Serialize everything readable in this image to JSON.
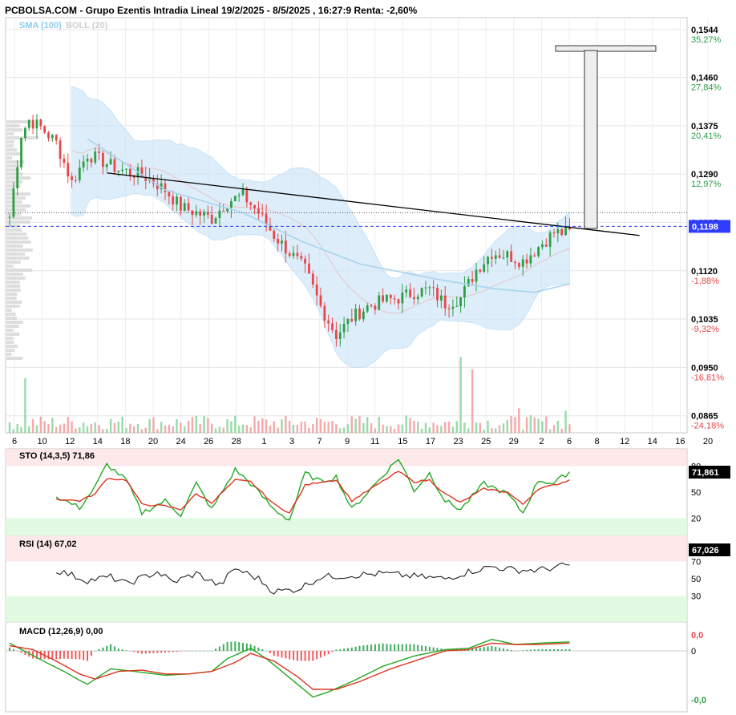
{
  "title": "PCBOLSA.COM - Grupo Ezentis Intradia Lineal 19/2/2025 - 8/5/2025 , 16:27:9 Renta: -2,60%",
  "legend": {
    "sma": "SMA (100)",
    "boll": "BOLL (20)"
  },
  "colors": {
    "up": "#2e9e44",
    "down": "#e8474a",
    "sma": "#a8d4ee",
    "boll_fill": "#cfe6f8",
    "trend": "#000000",
    "price_line": "#2f3cff",
    "stoch_k": "#22aa22",
    "stoch_d": "#dd3322",
    "rsi": "#222222"
  },
  "price_axis": [
    {
      "price": "0,1544",
      "pct": "35,27%"
    },
    {
      "price": "0,1460",
      "pct": "27,84%"
    },
    {
      "price": "0,1375",
      "pct": "20,41%"
    },
    {
      "price": "0,1290",
      "pct": "12,97%"
    },
    {
      "price": "0,1205",
      "pct": ""
    },
    {
      "price": "0,1120",
      "pct": "-1,88%"
    },
    {
      "price": "0,1035",
      "pct": "-9,32%"
    },
    {
      "price": "0,0950",
      "pct": "-16,81%"
    },
    {
      "price": "0,0865",
      "pct": "-24,18%"
    }
  ],
  "current_price": "0,1198",
  "date_labels": [
    "6",
    "10",
    "12",
    "14",
    "18",
    "20",
    "24",
    "26",
    "28",
    "1",
    "3",
    "7",
    "9",
    "11",
    "15",
    "17",
    "23",
    "25",
    "29",
    "2",
    "6",
    "8",
    "12",
    "14",
    "16",
    "20"
  ],
  "chart_data": [
    {
      "type": "candlestick",
      "title": "PCBOLSA.COM - Grupo Ezentis Intradia Lineal 19/2/2025 - 8/5/2025 , 16:27:9 Renta: -2,60%",
      "x_tick_labels": [
        "6",
        "10",
        "12",
        "14",
        "18",
        "20",
        "24",
        "26",
        "28",
        "1",
        "3",
        "7",
        "9",
        "11",
        "15",
        "17",
        "23",
        "25",
        "29",
        "2",
        "6",
        "8",
        "12",
        "14",
        "16",
        "20"
      ],
      "ylim": [
        0.0835,
        0.1565
      ],
      "close_path": [
        [
          0,
          0.1215
        ],
        [
          3,
          0.136
        ],
        [
          5,
          0.1385
        ],
        [
          8,
          0.1372
        ],
        [
          12,
          0.1345
        ],
        [
          16,
          0.1275
        ],
        [
          20,
          0.1325
        ],
        [
          24,
          0.1312
        ],
        [
          28,
          0.1298
        ],
        [
          32,
          0.1292
        ],
        [
          36,
          0.1282
        ],
        [
          40,
          0.1262
        ],
        [
          44,
          0.1232
        ],
        [
          48,
          0.1222
        ],
        [
          52,
          0.1212
        ],
        [
          56,
          0.1242
        ],
        [
          60,
          0.1252
        ],
        [
          64,
          0.1222
        ],
        [
          68,
          0.1182
        ],
        [
          72,
          0.1152
        ],
        [
          76,
          0.1122
        ],
        [
          80,
          0.1057
        ],
        [
          84,
          0.1007
        ],
        [
          88,
          0.1037
        ],
        [
          92,
          0.1057
        ],
        [
          96,
          0.1067
        ],
        [
          100,
          0.1072
        ],
        [
          104,
          0.1082
        ],
        [
          108,
          0.1087
        ],
        [
          112,
          0.1062
        ],
        [
          116,
          0.1072
        ],
        [
          120,
          0.1122
        ],
        [
          124,
          0.1152
        ],
        [
          128,
          0.1147
        ],
        [
          132,
          0.1137
        ],
        [
          136,
          0.1162
        ],
        [
          140,
          0.1187
        ],
        [
          144,
          0.1187
        ]
      ],
      "sma_100": [
        [
          20,
          0.1352
        ],
        [
          40,
          0.1262
        ],
        [
          60,
          0.1222
        ],
        [
          75,
          0.1172
        ],
        [
          90,
          0.1132
        ],
        [
          110,
          0.1105
        ],
        [
          125,
          0.1088
        ],
        [
          135,
          0.1082
        ],
        [
          144,
          0.1097
        ]
      ],
      "trendline": [
        [
          25,
          0.1292
        ],
        [
          162,
          0.1182
        ]
      ],
      "reference_line": 0.1222,
      "current_price": 0.1198,
      "volume_spikes": [
        [
          4,
          0.62
        ],
        [
          116,
          0.86
        ],
        [
          119,
          0.72
        ],
        [
          131,
          0.28
        ],
        [
          143,
          0.25
        ]
      ]
    },
    {
      "type": "line",
      "title": "STO (14,3,5)",
      "value": "71,86",
      "last": "71,861",
      "ylim": [
        0,
        100
      ],
      "bands": [
        20,
        80
      ],
      "k": [
        [
          12,
          45
        ],
        [
          18,
          32
        ],
        [
          22,
          56
        ],
        [
          25,
          82
        ],
        [
          30,
          64
        ],
        [
          34,
          26
        ],
        [
          40,
          40
        ],
        [
          44,
          24
        ],
        [
          48,
          60
        ],
        [
          52,
          30
        ],
        [
          58,
          76
        ],
        [
          62,
          60
        ],
        [
          68,
          30
        ],
        [
          72,
          18
        ],
        [
          76,
          72
        ],
        [
          80,
          62
        ],
        [
          84,
          68
        ],
        [
          88,
          30
        ],
        [
          100,
          89
        ],
        [
          104,
          52
        ],
        [
          108,
          72
        ],
        [
          112,
          40
        ],
        [
          116,
          30
        ],
        [
          122,
          60
        ],
        [
          128,
          48
        ],
        [
          132,
          26
        ],
        [
          136,
          64
        ],
        [
          140,
          60
        ],
        [
          144,
          74
        ]
      ],
      "d": [
        [
          12,
          42
        ],
        [
          18,
          40
        ],
        [
          22,
          48
        ],
        [
          25,
          66
        ],
        [
          30,
          64
        ],
        [
          34,
          36
        ],
        [
          40,
          34
        ],
        [
          44,
          30
        ],
        [
          48,
          48
        ],
        [
          52,
          38
        ],
        [
          58,
          64
        ],
        [
          62,
          62
        ],
        [
          68,
          36
        ],
        [
          72,
          26
        ],
        [
          76,
          58
        ],
        [
          80,
          62
        ],
        [
          84,
          64
        ],
        [
          88,
          40
        ],
        [
          100,
          74
        ],
        [
          104,
          62
        ],
        [
          108,
          64
        ],
        [
          112,
          48
        ],
        [
          116,
          38
        ],
        [
          122,
          54
        ],
        [
          128,
          50
        ],
        [
          132,
          36
        ],
        [
          136,
          54
        ],
        [
          140,
          58
        ],
        [
          144,
          64
        ]
      ]
    },
    {
      "type": "line",
      "title": "RSI (14)",
      "value": "67,02",
      "last": "67,026",
      "ylim": [
        0,
        100
      ],
      "bands": [
        30,
        70
      ],
      "values": [
        [
          12,
          60
        ],
        [
          20,
          48
        ],
        [
          26,
          52
        ],
        [
          30,
          44
        ],
        [
          38,
          58
        ],
        [
          42,
          46
        ],
        [
          48,
          56
        ],
        [
          54,
          42
        ],
        [
          58,
          62
        ],
        [
          64,
          50
        ],
        [
          68,
          35
        ],
        [
          74,
          38
        ],
        [
          80,
          52
        ],
        [
          88,
          54
        ],
        [
          96,
          56
        ],
        [
          106,
          52
        ],
        [
          112,
          50
        ],
        [
          118,
          58
        ],
        [
          124,
          64
        ],
        [
          130,
          60
        ],
        [
          136,
          60
        ],
        [
          144,
          66
        ]
      ]
    },
    {
      "type": "line",
      "title": "MACD (12,26,9)",
      "value": "0,00",
      "top_label": "0,0",
      "bottom_label": "-0,0",
      "macd": [
        [
          0,
          0.6
        ],
        [
          5,
          -0.2
        ],
        [
          10,
          -1.0
        ],
        [
          14,
          -1.6
        ],
        [
          18,
          -2.3
        ],
        [
          20,
          -2.6
        ],
        [
          26,
          -1.4
        ],
        [
          32,
          -1.6
        ],
        [
          40,
          -1.9
        ],
        [
          46,
          -1.8
        ],
        [
          52,
          -1.6
        ],
        [
          56,
          -0.6
        ],
        [
          62,
          0.2
        ],
        [
          66,
          -0.6
        ],
        [
          70,
          -1.6
        ],
        [
          74,
          -2.6
        ],
        [
          78,
          -3.6
        ],
        [
          82,
          -3.2
        ],
        [
          88,
          -2.4
        ],
        [
          96,
          -1.2
        ],
        [
          104,
          -0.4
        ],
        [
          112,
          0.1
        ],
        [
          118,
          0.2
        ],
        [
          124,
          0.9
        ],
        [
          130,
          0.5
        ],
        [
          136,
          0.6
        ],
        [
          144,
          0.7
        ]
      ],
      "signal": [
        [
          0,
          0.4
        ],
        [
          6,
          0.1
        ],
        [
          12,
          -0.8
        ],
        [
          18,
          -1.8
        ],
        [
          22,
          -2.2
        ],
        [
          28,
          -1.6
        ],
        [
          34,
          -1.5
        ],
        [
          40,
          -1.8
        ],
        [
          46,
          -1.8
        ],
        [
          52,
          -1.6
        ],
        [
          58,
          -0.9
        ],
        [
          62,
          -0.2
        ],
        [
          68,
          -0.8
        ],
        [
          74,
          -2.0
        ],
        [
          78,
          -3.0
        ],
        [
          84,
          -3.0
        ],
        [
          90,
          -2.4
        ],
        [
          98,
          -1.4
        ],
        [
          106,
          -0.6
        ],
        [
          112,
          0.0
        ],
        [
          118,
          0.1
        ],
        [
          124,
          0.6
        ],
        [
          130,
          0.5
        ],
        [
          136,
          0.5
        ],
        [
          144,
          0.6
        ]
      ]
    }
  ]
}
